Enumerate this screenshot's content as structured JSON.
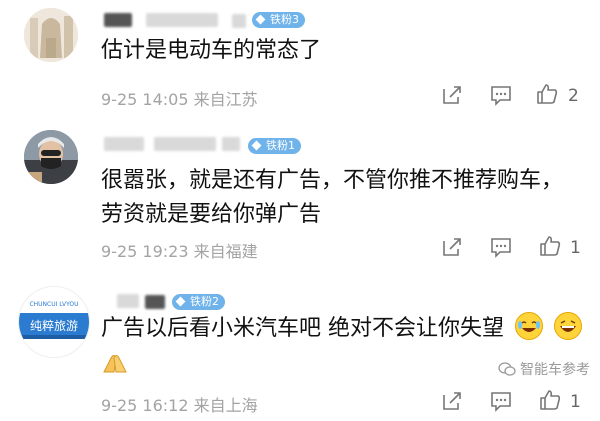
{
  "comments": [
    {
      "badge": "铁粉3",
      "text_lines": [
        "估计是电动车的常态了"
      ],
      "meta": "9-25 14:05  来自江苏",
      "likes": "2"
    },
    {
      "badge": "铁粉1",
      "text_lines": [
        "很嚣张，就是还有广告，不管你推不推荐购车，",
        "劳资就是要给你弹广告"
      ],
      "meta": "9-25 19:23  来自福建",
      "likes": "1"
    },
    {
      "badge": "铁粉2",
      "text_lines": [
        "广告以后看小米汽车吧 绝对不会让你失望"
      ],
      "meta": "9-25 16:12  来自上海",
      "likes": "1"
    }
  ],
  "avatar3_text": {
    "line1": "CHUNCUI LVYOU",
    "line2": "纯粹旅游"
  },
  "watermark": "智能车参考",
  "colors": {
    "badge": "#6fb3ea",
    "meta": "#a3a3a3",
    "text": "#111111"
  },
  "icons": [
    "share-icon",
    "comment-icon",
    "like-icon"
  ]
}
